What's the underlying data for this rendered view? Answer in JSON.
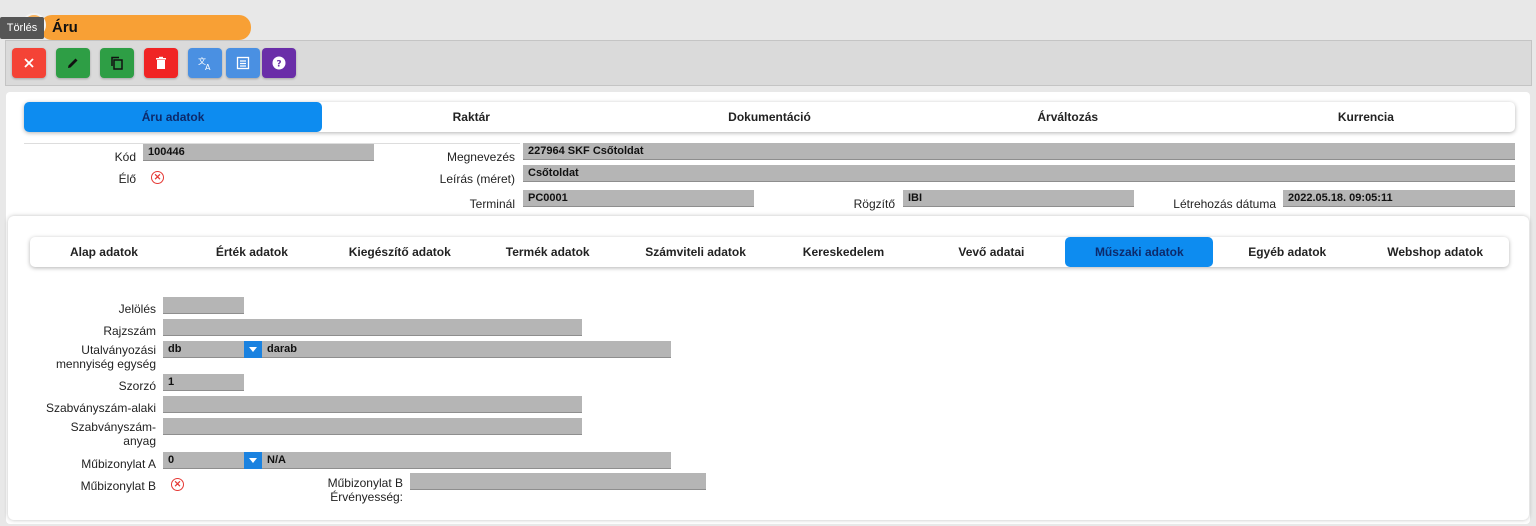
{
  "tooltip": "Törlés",
  "app": {
    "title": "Áru"
  },
  "colors": {
    "accent": "#0d8cf0",
    "title_pill": "#f8a035",
    "btn_red": "#f44336",
    "btn_green": "#2e9e45",
    "btn_blue": "#4a90e2",
    "btn_purple": "#6a2ea8"
  },
  "toolbar": [
    {
      "name": "close-button",
      "icon": "close-icon"
    },
    {
      "name": "edit-button",
      "icon": "pencil-icon"
    },
    {
      "name": "copy-button",
      "icon": "copy-icon"
    },
    {
      "name": "delete-button",
      "icon": "trash-icon"
    },
    {
      "name": "translate-button",
      "icon": "translate-icon"
    },
    {
      "name": "list-button",
      "icon": "list-icon"
    },
    {
      "name": "help-button",
      "icon": "help-icon"
    }
  ],
  "main_tabs": [
    "Áru adatok",
    "Raktár",
    "Dokumentáció",
    "Árváltozás",
    "Kurrencia"
  ],
  "main_tab_active": "Áru adatok",
  "header": {
    "kod_label": "Kód",
    "kod": "100446",
    "elo_label": "Élő",
    "megnevezes_label": "Megnevezés",
    "megnevezes": "227964 SKF Csőtoldat",
    "leiras_label": "Leírás (méret)",
    "leiras": "Csőtoldat",
    "terminal_label": "Terminál",
    "terminal": "PC0001",
    "rogzito_label": "Rögzítő",
    "rogzito": "IBI",
    "letrehozas_label": "Létrehozás dátuma",
    "letrehozas": "2022.05.18. 09:05:11"
  },
  "sub_tabs": [
    "Alap adatok",
    "Érték adatok",
    "Kiegészítő adatok",
    "Termék adatok",
    "Számviteli adatok",
    "Kereskedelem",
    "Vevő adatai",
    "Műszaki adatok",
    "Egyéb adatok",
    "Webshop adatok"
  ],
  "sub_tab_active": "Műszaki adatok",
  "form": {
    "jeloles_label": "Jelölés",
    "jeloles": "",
    "rajzszam_label": "Rajzszám",
    "rajzszam": "",
    "utalvanyozasi_label_1": "Utalványozási",
    "utalvanyozasi_label_2": "mennyiség egység",
    "utalvanyozasi_code": "db",
    "utalvanyozasi_name": "darab",
    "szorzo_label": "Szorzó",
    "szorzo": "1",
    "szabvany_alaki_label": "Szabványszám-alaki",
    "szabvany_alaki": "",
    "szabvany_anyag_label_1": "Szabványszám-",
    "szabvany_anyag_label_2": "anyag",
    "szabvany_anyag": "",
    "mubizonylat_a_label": "Műbizonylat A",
    "mubizonylat_a_code": "0",
    "mubizonylat_a_name": "N/A",
    "mubizonylat_b_label": "Műbizonylat B",
    "mubizonylat_b_erv_label_1": "Műbizonylat B",
    "mubizonylat_b_erv_label_2": "Érvényesség:",
    "mubizonylat_b_erv": ""
  }
}
